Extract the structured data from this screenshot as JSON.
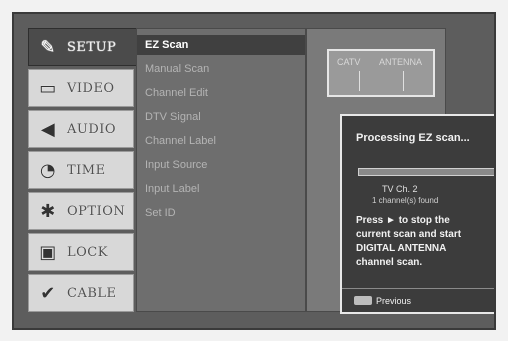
{
  "categories": [
    {
      "label": "SETUP",
      "icon": "wrench-icon"
    },
    {
      "label": "VIDEO",
      "icon": "tv-icon"
    },
    {
      "label": "AUDIO",
      "icon": "speaker-icon"
    },
    {
      "label": "TIME",
      "icon": "clock-icon"
    },
    {
      "label": "OPTION",
      "icon": "gear-icon"
    },
    {
      "label": "LOCK",
      "icon": "lock-icon"
    },
    {
      "label": "CABLE",
      "icon": "check-icon"
    }
  ],
  "submenu": [
    "EZ Scan",
    "Manual Scan",
    "Channel Edit",
    "DTV Signal",
    "Channel Label",
    "Input Source",
    "Input Label",
    "Set ID"
  ],
  "background_panel": {
    "antenna_left": "CATV",
    "antenna_right": "ANTENNA"
  },
  "dialog": {
    "title": "Processing EZ scan...",
    "progress_fraction": 0.0,
    "channel": "TV Ch. 2",
    "found": "1 channel(s) found",
    "message_lines": [
      "Press ► to stop the",
      "current scan and start",
      "DIGITAL ANTENNA",
      "channel scan."
    ],
    "footer_label": "Previous"
  }
}
